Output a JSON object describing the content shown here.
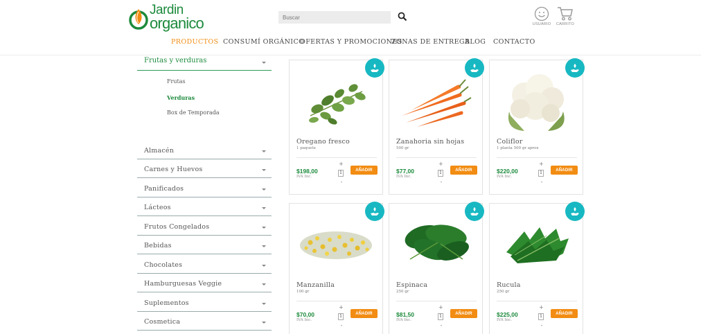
{
  "brand": {
    "line1": "Jardin",
    "line2": "organico",
    "green": "#1c8a3c",
    "orange": "#f28c12",
    "teal": "#17b8c2"
  },
  "search": {
    "placeholder": "Buscar",
    "icon": "search-icon"
  },
  "header_actions": {
    "user_label": "USUARIO",
    "cart_label": "CARRITO"
  },
  "nav": [
    {
      "label": "PRODUCTOS",
      "active": true
    },
    {
      "label": "CONSUMÍ ORGÁNICO",
      "active": false
    },
    {
      "label": "OFERTAS Y PROMOCIONES",
      "active": false
    },
    {
      "label": "ZONAS DE ENTREGA",
      "active": false
    },
    {
      "label": "BLOG",
      "active": false
    },
    {
      "label": "CONTACTO",
      "active": false
    }
  ],
  "sidebar": {
    "open_category": "Frutas y verduras",
    "subcategories": [
      {
        "label": "Frutas",
        "active": false
      },
      {
        "label": "Verduras",
        "active": true
      },
      {
        "label": "Box de Temporada",
        "active": false
      }
    ],
    "categories": [
      "Almacén",
      "Carnes y Huevos",
      "Panificados",
      "Lácteos",
      "Frutos Congelados",
      "Bebidas",
      "Chocolates",
      "Hamburguesas Veggie",
      "Suplementos",
      "Cosmetica"
    ]
  },
  "products": [
    {
      "name": "Oregano fresco",
      "qty": "1 paquete",
      "price": "$198,00",
      "tax": "IVA Inc.",
      "quantity": "1",
      "add_label": "AÑADIR",
      "plus": "+",
      "minus": "-",
      "image": "oregano-image"
    },
    {
      "name": "Zanahoria sin hojas",
      "qty": "500 gr",
      "price": "$77,00",
      "tax": "IVA Inc.",
      "quantity": "1",
      "add_label": "AÑADIR",
      "plus": "+",
      "minus": "-",
      "image": "carrots-image"
    },
    {
      "name": "Coliflor",
      "qty": "1 planta 500 gr aprox",
      "price": "$220,00",
      "tax": "IVA Inc.",
      "quantity": "1",
      "add_label": "AÑADIR",
      "plus": "+",
      "minus": "-",
      "image": "cauliflower-image"
    },
    {
      "name": "Manzanilla",
      "qty": "100 gr",
      "price": "$70,00",
      "tax": "IVA Inc.",
      "quantity": "1",
      "add_label": "AÑADIR",
      "plus": "+",
      "minus": "-",
      "image": "chamomile-image"
    },
    {
      "name": "Espinaca",
      "qty": "250 gr",
      "price": "$81,50",
      "tax": "IVA Inc.",
      "quantity": "1",
      "add_label": "AÑADIR",
      "plus": "+",
      "minus": "-",
      "image": "spinach-image"
    },
    {
      "name": "Rucula",
      "qty": "250 gr",
      "price": "$225,00",
      "tax": "IVA Inc.",
      "quantity": "1",
      "add_label": "AÑADIR",
      "plus": "+",
      "minus": "-",
      "image": "arugula-image"
    }
  ]
}
